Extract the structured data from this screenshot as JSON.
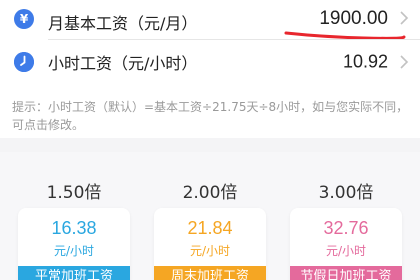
{
  "monthly_wage": {
    "icon": "yen-icon",
    "label": "月基本工资（元/月）",
    "value": "1900.00"
  },
  "hourly_wage": {
    "icon": "clock-icon",
    "label": "小时工资（元/小时）",
    "value": "10.92"
  },
  "hint": "提示：小时工资（默认）=基本工资÷21.75天÷8小时，如与您实际不同，可点击修改。",
  "colors": {
    "icon_blue": "#3e7be8",
    "annotation_red": "#e8262d",
    "rate_1": "#2aa7e0",
    "rate_2": "#f5a623",
    "rate_3": "#e46a9c"
  },
  "rates": [
    {
      "multiplier": "1.50倍",
      "value": "16.38",
      "unit": "元/小时",
      "type": "平常加班工资"
    },
    {
      "multiplier": "2.00倍",
      "value": "21.84",
      "unit": "元/小时",
      "type": "周末加班工资"
    },
    {
      "multiplier": "3.00倍",
      "value": "32.76",
      "unit": "元/小时",
      "type": "节假日加班工资"
    }
  ]
}
